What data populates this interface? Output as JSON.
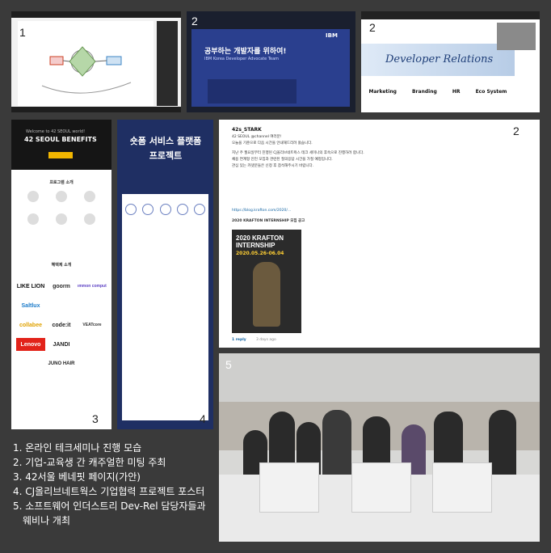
{
  "panel_1a": {
    "number": "1"
  },
  "panel_1b": {
    "number": "2",
    "slide_title": "공부하는 개발자를 위하여!",
    "slide_subtitle": "IBM Korea Developer Advocate Team",
    "brand": "IBM"
  },
  "panel_1c": {
    "number": "2",
    "slide_title": "Developer Relations",
    "tags": [
      "Marketing",
      "Branding",
      "HR",
      "Eco System"
    ]
  },
  "panel_3": {
    "number": "3",
    "welcome": "Welcome to 42 SEOUL world!",
    "title": "42 SEOUL BENEFITS",
    "program_heading": "프로그램 소개",
    "sponsor_heading": "혜택제 소개",
    "logos": [
      "LIKE LION",
      "goorm",
      "common computer",
      "Saltlux",
      "",
      "",
      "collabee",
      "code:it",
      "VEATcore",
      "Lenovo",
      "JANDI",
      "",
      "",
      "JUNO HAIR",
      ""
    ]
  },
  "panel_4": {
    "number": "4",
    "title_line1": "숏폼 서비스 플랫폼",
    "title_line2": "프로젝트"
  },
  "panel_2": {
    "number": "2",
    "author": "42s_STARK",
    "lines": [
      "42 SEOUL @channel 여러분!",
      "오늘을 기준으로 다음 시간을 안내해드리려 왔습니다.",
      "지난 주 월요일부터 진행된 CJ올리브네트웍스 테크 세미나의 후속으로 진행하려 합니다.",
      "채용 연계형 인턴 모집과 관련된 질의응답 시간을 가질 예정입니다.",
      "관심 있는 카뎃분들은 신청 후 참석해주시기 바랍니다.",
      "https://blog.krafton.com/2020/...",
      "2020 KRAFTON INTERNSHIP 모집 공고"
    ],
    "poster_line1": "2020 KRAFTON",
    "poster_line2": "INTERNSHIP",
    "poster_dates": "2020.05.26-06.04",
    "reply": "1 reply",
    "reply_time": "3 days ago"
  },
  "panel_5": {
    "number": "5"
  },
  "captions": [
    "1. 온라인 테크세미나 진행 모습",
    "2. 기업-교육생 간 캐주얼한 미팅 주최",
    "3. 42서울 베네핏 페이지(가안)",
    "4. CJ올리브네트웍스 기업협력 프로젝트 포스터",
    "5. 소프트웨어 인더스트리 Dev-Rel 담당자들과",
    "   웨비나 개최"
  ]
}
